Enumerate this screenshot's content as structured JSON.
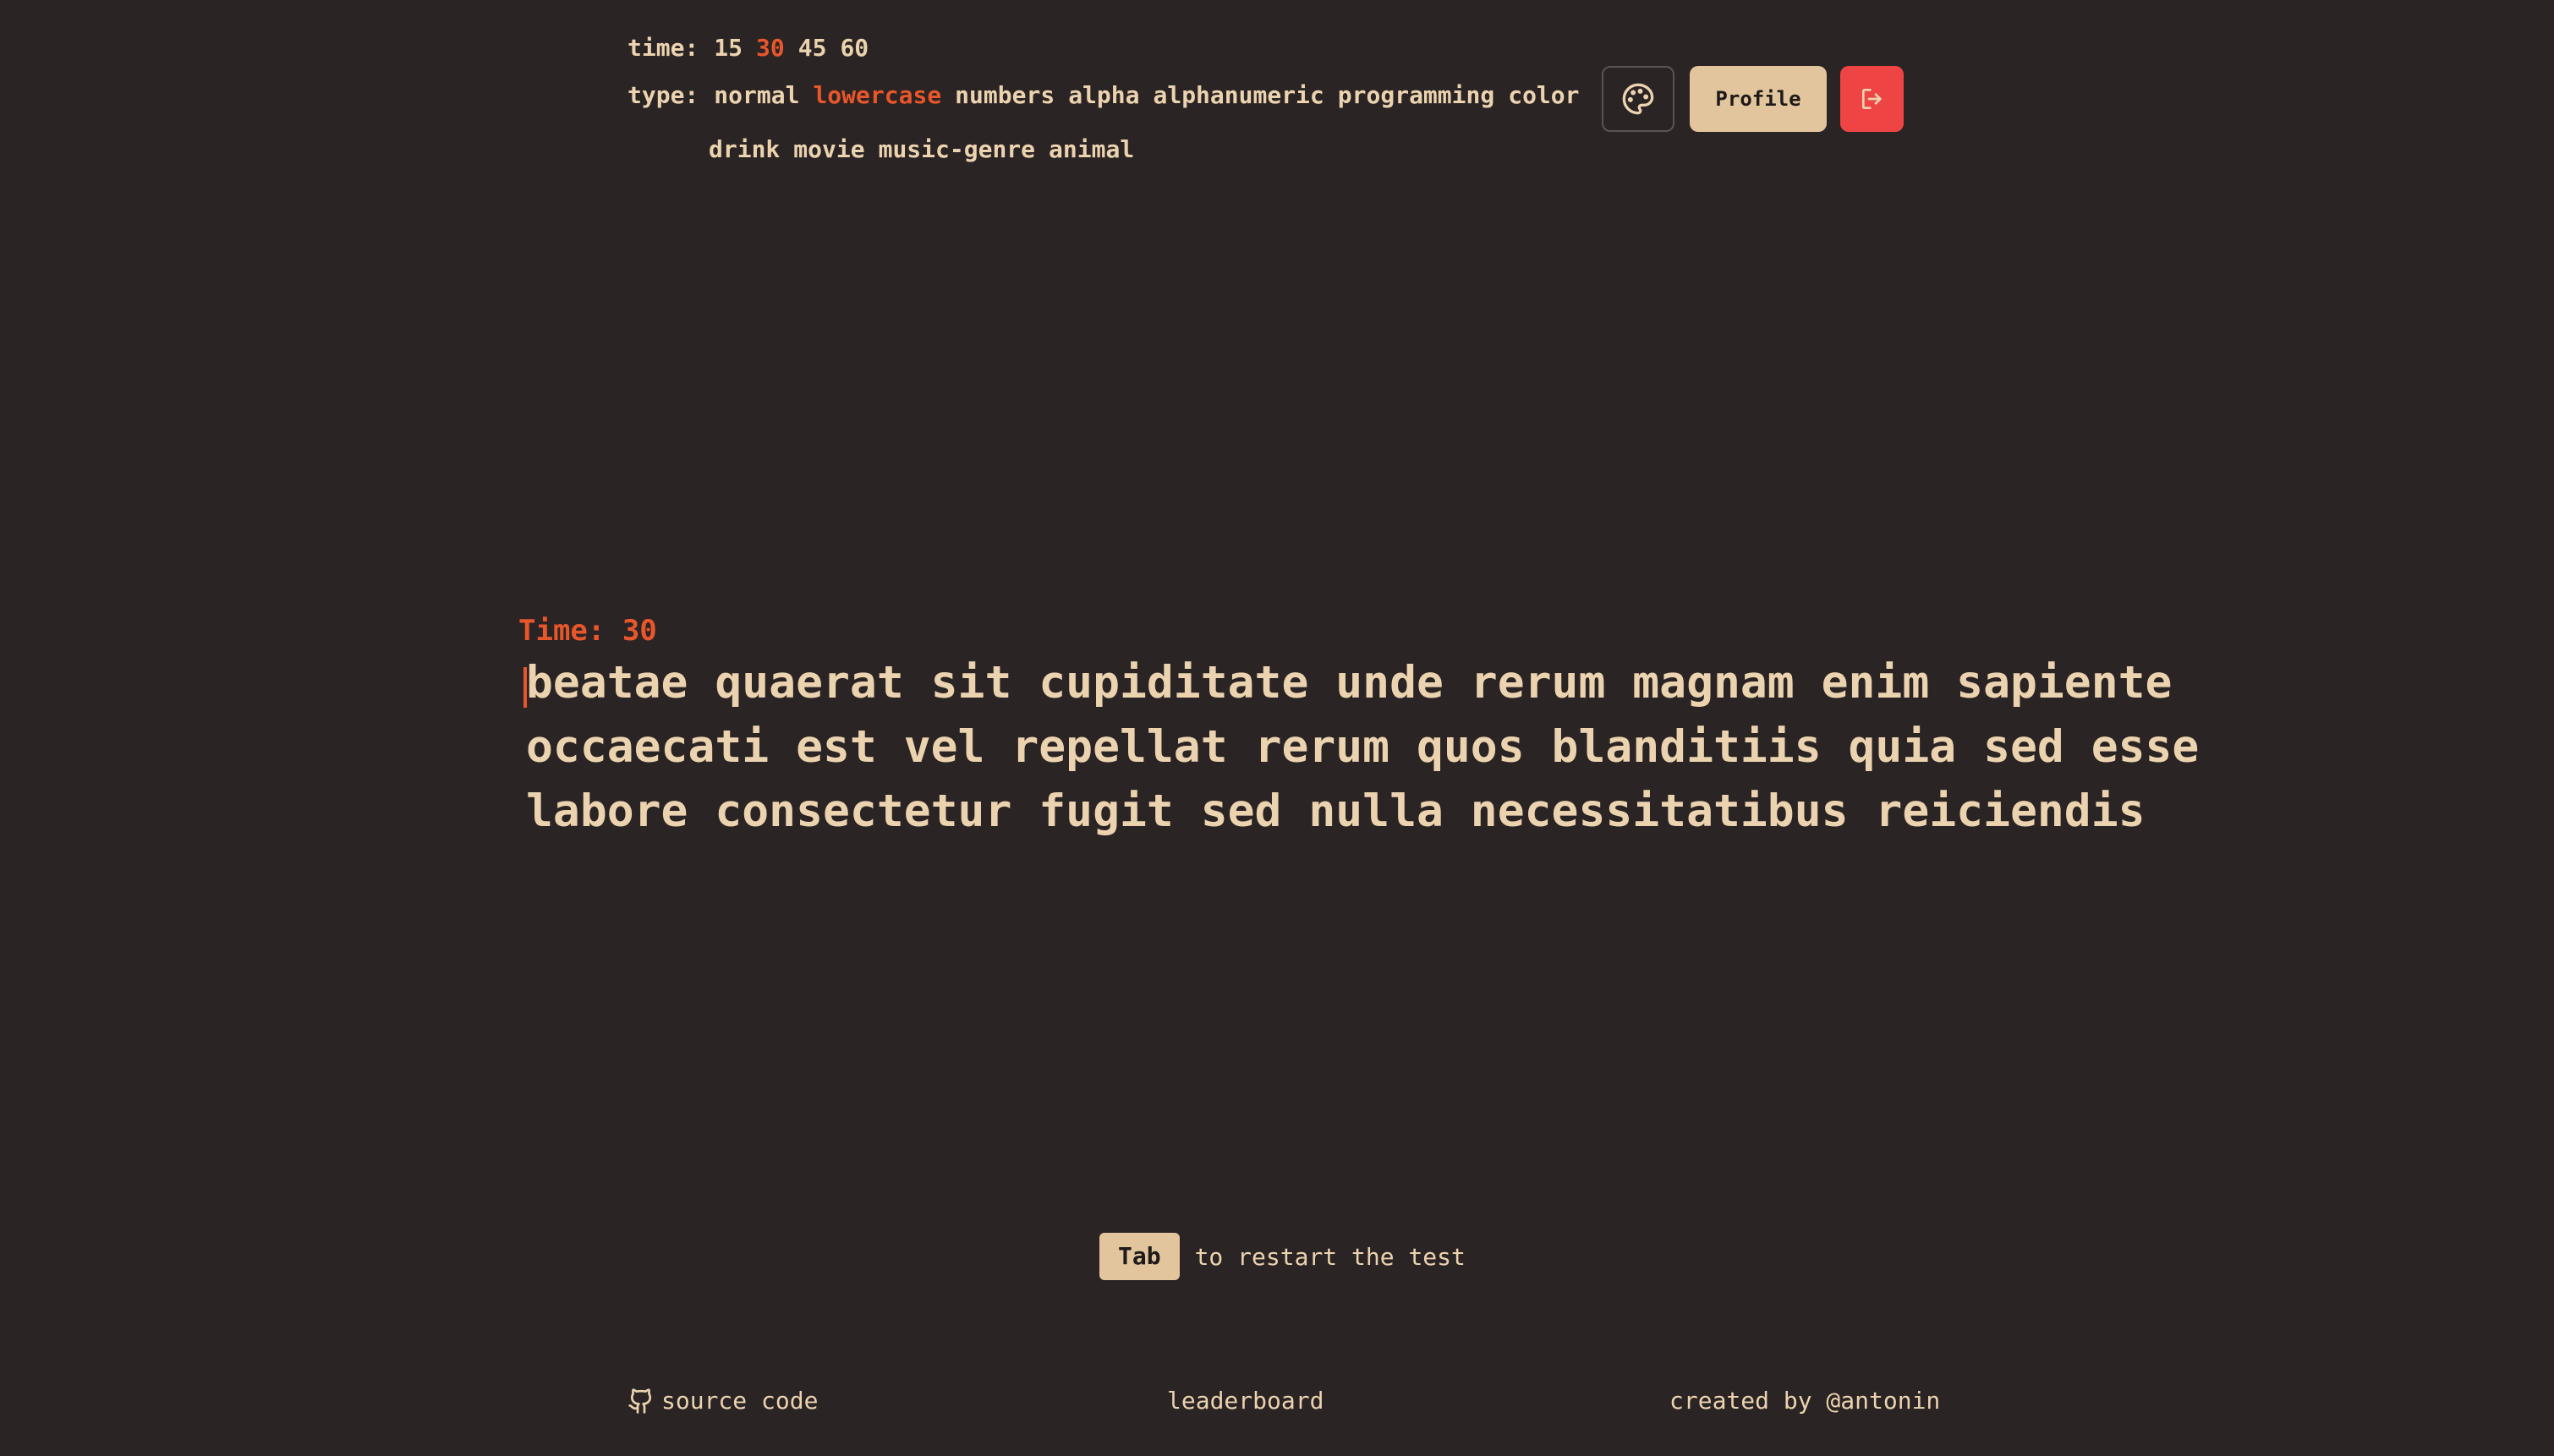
{
  "header": {
    "time": {
      "label": "time:",
      "options": [
        "15",
        "30",
        "45",
        "60"
      ],
      "active": "30"
    },
    "type": {
      "label": "type:",
      "options_line1": [
        "normal",
        "lowercase",
        "numbers",
        "alpha",
        "alphanumeric",
        "programming",
        "color"
      ],
      "options_line2": [
        "drink",
        "movie",
        "music-genre",
        "animal"
      ],
      "active": "lowercase"
    },
    "buttons": {
      "palette_icon": "palette-icon",
      "profile_label": "Profile",
      "logout_icon": "logout-icon"
    }
  },
  "test": {
    "timer_text": "Time: 30",
    "lines": [
      "beatae quaerat sit cupiditate unde rerum magnam enim sapiente",
      "occaecati est vel repellat rerum quos blanditiis quia sed esse",
      "labore consectetur fugit sed nulla necessitatibus reiciendis"
    ]
  },
  "hint": {
    "key": "Tab",
    "text": "to restart the test"
  },
  "footer": {
    "source": "source code",
    "leaderboard": "leaderboard",
    "created": "created by @antonin"
  },
  "colors": {
    "background": "#2b2424",
    "text": "#ecd3b0",
    "accent": "#e8562b",
    "button": "#e2c59c",
    "danger": "#ef4444"
  }
}
